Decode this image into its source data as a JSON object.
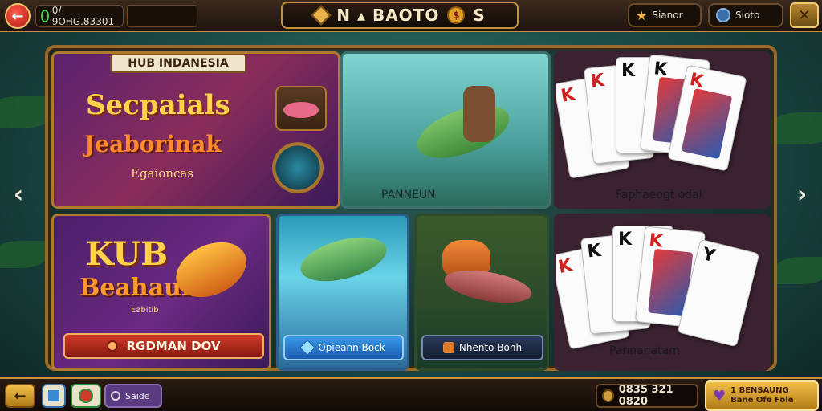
{
  "topbar": {
    "balance_text": "0/ 9OHG.83301",
    "banner_text": "N ▴ BAOTO",
    "badge_letter": "S",
    "pill1_label": "Sianor",
    "pill2_label": "Sioto"
  },
  "cards": {
    "card1": {
      "plate": "HUB INDANESIA",
      "line1": "Secpaials",
      "line2": "Jeaborinak",
      "line3": "Egaioncas"
    },
    "card2": {
      "label": "PANNEUN"
    },
    "card3": {
      "label": "Faphaeogt odal"
    },
    "card4": {
      "line1": "KUB",
      "line2": "Beahauls",
      "line3": "Eabitib",
      "button": "RGDMAN DOV"
    },
    "card5": {
      "button": "Opieann Bock"
    },
    "card6": {
      "button": "Nhento Bonh"
    },
    "card7": {
      "label": "Pannanatam"
    }
  },
  "playing_cards": {
    "card3": [
      "K",
      "K",
      "K",
      "K"
    ],
    "card7": [
      "K",
      "K",
      "K",
      "Y"
    ]
  },
  "bottombar": {
    "pill_label": "Saide",
    "coins": "0835 321 0820",
    "promo_line1": "1 BENSAUNG",
    "promo_line2": "Bane Ofe Fole"
  },
  "colors": {
    "gold": "#c9913b",
    "accent_red": "#d03a2a",
    "accent_blue": "#3a9ae8"
  }
}
